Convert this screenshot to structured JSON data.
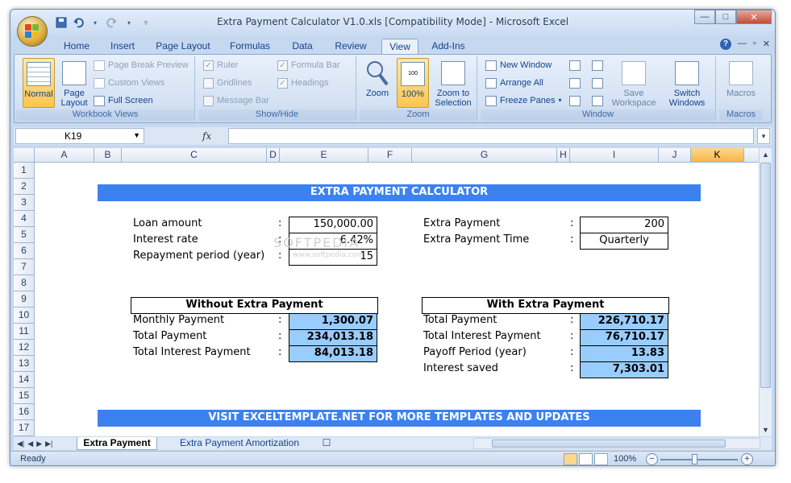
{
  "window": {
    "title": "Extra Payment Calculator V1.0.xls  [Compatibility Mode] - Microsoft Excel",
    "controls": {
      "minimize": "—",
      "maximize": "□",
      "close": "✕"
    }
  },
  "qat": [
    "save-icon",
    "undo-icon",
    "redo-icon",
    "customize-icon"
  ],
  "tabs": [
    "Home",
    "Insert",
    "Page Layout",
    "Formulas",
    "Data",
    "Review",
    "View",
    "Add-Ins"
  ],
  "active_tab": "View",
  "ribbon_controls": {
    "help": "?",
    "minimize": "—",
    "restore": "▫",
    "close": "✕"
  },
  "ribbon": {
    "workbook_views": {
      "label": "Workbook Views",
      "normal": "Normal",
      "page_layout": "Page Layout",
      "page_break_preview": "Page Break Preview",
      "custom_views": "Custom Views",
      "full_screen": "Full Screen"
    },
    "show_hide": {
      "label": "Show/Hide",
      "ruler": "Ruler",
      "gridlines": "Gridlines",
      "message_bar": "Message Bar",
      "formula_bar": "Formula Bar",
      "headings": "Headings"
    },
    "zoom": {
      "label": "Zoom",
      "zoom": "Zoom",
      "hundred": "100%",
      "zoom_to_selection": "Zoom to Selection"
    },
    "window": {
      "label": "Window",
      "new_window": "New Window",
      "arrange_all": "Arrange All",
      "freeze_panes": "Freeze Panes",
      "save_workspace": "Save Workspace",
      "switch_windows": "Switch Windows"
    },
    "macros": {
      "label": "Macros",
      "macros": "Macros"
    }
  },
  "formula_bar": {
    "name_box": "K19",
    "fx": "fx",
    "value": ""
  },
  "columns": [
    "A",
    "B",
    "C",
    "D",
    "E",
    "F",
    "G",
    "H",
    "I",
    "J",
    "K"
  ],
  "selected_column": "K",
  "rows": [
    "1",
    "2",
    "3",
    "4",
    "5",
    "6",
    "7",
    "8",
    "9",
    "10",
    "11",
    "12",
    "13",
    "14",
    "15",
    "16",
    "17"
  ],
  "sheet": {
    "title": "EXTRA PAYMENT CALCULATOR",
    "inputs_left": [
      {
        "label": "Loan amount",
        "value": "150,000.00"
      },
      {
        "label": "Interest rate",
        "value": "6.42%"
      },
      {
        "label": "Repayment period (year)",
        "value": "15"
      }
    ],
    "inputs_right": [
      {
        "label": "Extra Payment",
        "value": "200"
      },
      {
        "label": "Extra Payment Time",
        "value": "Quarterly"
      }
    ],
    "without": {
      "header": "Without Extra Payment",
      "rows": [
        {
          "label": "Monthly Payment",
          "value": "1,300.07"
        },
        {
          "label": "Total Payment",
          "value": "234,013.18"
        },
        {
          "label": "Total Interest Payment",
          "value": "84,013.18"
        }
      ]
    },
    "with": {
      "header": "With Extra Payment",
      "rows": [
        {
          "label": "Total Payment",
          "value": "226,710.17"
        },
        {
          "label": "Total Interest Payment",
          "value": "76,710.17"
        },
        {
          "label": "Payoff Period (year)",
          "value": "13.83"
        },
        {
          "label": "Interest saved",
          "value": "7,303.01"
        }
      ]
    },
    "footer": "VISIT EXCELTEMPLATE.NET FOR MORE TEMPLATES AND UPDATES",
    "colon": ":",
    "watermark": "SOFTPEDIA",
    "watermark_url": "www.softpedia.com"
  },
  "sheet_tabs": [
    "Extra Payment",
    "Extra Payment Amortization"
  ],
  "status": {
    "ready": "Ready",
    "zoom": "100%"
  },
  "colors": {
    "banner": "#3b82f0",
    "result_fill": "#99ccff",
    "selected_header": "#f8b44a"
  }
}
